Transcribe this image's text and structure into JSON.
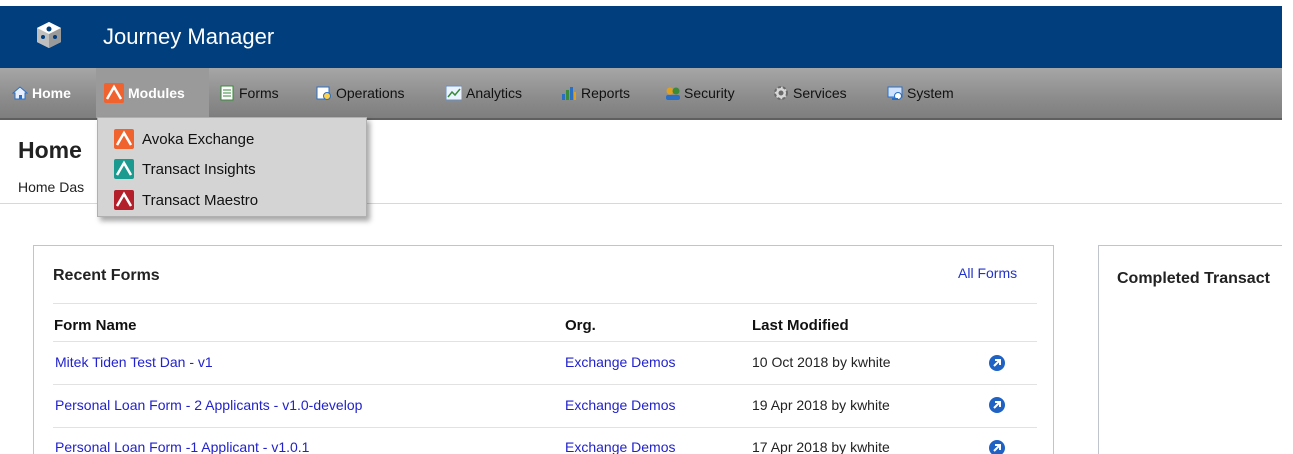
{
  "app": {
    "title": "Journey Manager"
  },
  "nav": {
    "items": [
      {
        "label": "Home",
        "icon": "home-icon"
      },
      {
        "label": "Modules",
        "icon": "modules-icon"
      },
      {
        "label": "Forms",
        "icon": "forms-icon"
      },
      {
        "label": "Operations",
        "icon": "operations-icon"
      },
      {
        "label": "Analytics",
        "icon": "analytics-icon"
      },
      {
        "label": "Reports",
        "icon": "reports-icon"
      },
      {
        "label": "Security",
        "icon": "security-icon"
      },
      {
        "label": "Services",
        "icon": "services-icon"
      },
      {
        "label": "System",
        "icon": "system-icon"
      }
    ]
  },
  "modules_menu": {
    "items": [
      {
        "label": "Avoka Exchange",
        "color": "#f0622e"
      },
      {
        "label": "Transact Insights",
        "color": "#1b9a8f"
      },
      {
        "label": "Transact Maestro",
        "color": "#b3202c"
      }
    ]
  },
  "page": {
    "title": "Home",
    "breadcrumb": "Home Das"
  },
  "recent_forms": {
    "title": "Recent Forms",
    "all_forms_link": "All Forms",
    "columns": [
      "Form Name",
      "Org.",
      "Last Modified"
    ],
    "rows": [
      {
        "name": "Mitek Tiden Test Dan  -  v1",
        "org": "Exchange Demos",
        "modified": "10 Oct 2018 by kwhite"
      },
      {
        "name": "Personal Loan Form - 2 Applicants  -  v1.0-develop",
        "org": "Exchange Demos",
        "modified": "19 Apr 2018 by kwhite"
      },
      {
        "name": "Personal Loan Form -1 Applicant  -  v1.0.1",
        "org": "Exchange Demos",
        "modified": "17 Apr 2018 by kwhite"
      }
    ]
  },
  "completed_panel": {
    "title": "Completed Transact"
  },
  "colors": {
    "header_bg": "#003e7e",
    "link": "#2222cc",
    "nav_bg": "#8c8c8c"
  }
}
